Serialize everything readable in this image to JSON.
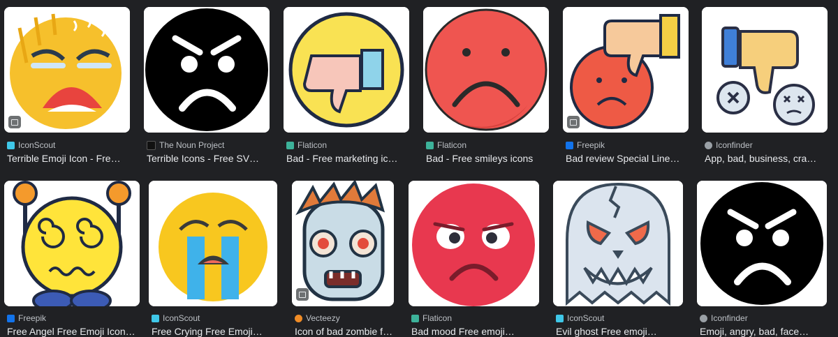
{
  "results": [
    {
      "source": "IconScout",
      "title": "Terrible Emoji Icon - Fre…",
      "fav_color": "#3fc7e8",
      "icon": "tired-yellow-emoji-icon"
    },
    {
      "source": "The Noun Project",
      "title": "Terrible Icons - Free SV…",
      "fav_color": "#111111",
      "icon": "angry-black-face-icon"
    },
    {
      "source": "Flaticon",
      "title": "Bad - Free marketing ic…",
      "fav_color": "#3db29a",
      "icon": "thumbs-down-badge-icon"
    },
    {
      "source": "Flaticon",
      "title": "Bad - Free smileys icons",
      "fav_color": "#3db29a",
      "icon": "sad-red-face-icon"
    },
    {
      "source": "Freepik",
      "title": "Bad review Special Line…",
      "fav_color": "#1273eb",
      "icon": "bad-review-thumb-face-icon"
    },
    {
      "source": "Iconfinder",
      "title": "App, bad, business, cra…",
      "fav_color": "#9aa0a6",
      "icon": "thumbs-down-dizzy-icon"
    },
    {
      "source": "Freepik",
      "title": "Free Angel Free Emoji Icon…",
      "fav_color": "#1273eb",
      "icon": "dizzy-emoji-hands-up-icon"
    },
    {
      "source": "IconScout",
      "title": "Free Crying Free Emoji…",
      "fav_color": "#3fc7e8",
      "icon": "crying-emoji-icon"
    },
    {
      "source": "Vecteezy",
      "title": "Icon of bad zombie face…",
      "fav_color": "#f08c26",
      "icon": "zombie-face-icon"
    },
    {
      "source": "Flaticon",
      "title": "Bad mood Free emoji…",
      "fav_color": "#3db29a",
      "icon": "frowning-red-face-icon"
    },
    {
      "source": "IconScout",
      "title": "Evil ghost Free emoji…",
      "fav_color": "#3fc7e8",
      "icon": "evil-ghost-icon"
    },
    {
      "source": "Iconfinder",
      "title": "Emoji, angry, bad, face…",
      "fav_color": "#9aa0a6",
      "icon": "angry-black-face-icon"
    }
  ]
}
